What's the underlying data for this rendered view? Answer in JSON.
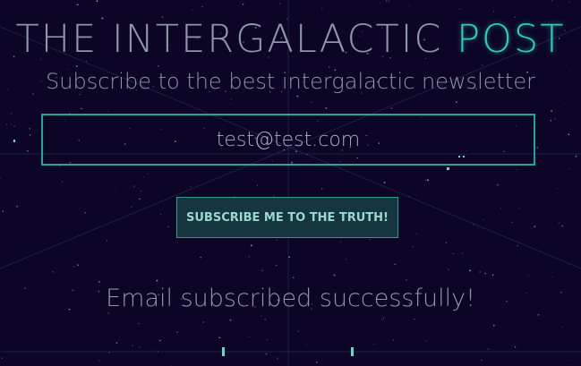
{
  "header": {
    "title_main": "THE INTERGALACTIC",
    "title_accent": "POST",
    "subtitle": "Subscribe to the best intergalactic newsletter"
  },
  "form": {
    "email_value": "test@test.com",
    "submit_label": "SUBSCRIBE ME TO THE TRUTH!"
  },
  "status": {
    "message": "Email subscribed successfully!"
  },
  "colors": {
    "background": "#0d0526",
    "accent": "#23d3bd",
    "text": "#8e97a8",
    "field_border": "#1fa89a",
    "button_bg": "#16363f"
  }
}
